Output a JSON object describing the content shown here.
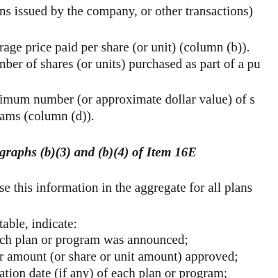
{
  "document": {
    "lines": [
      "ns issued by the company, or other transactions)",
      "rage price paid per share (or unit) (column (b)).",
      "nber of shares (or units) purchased as part of a pu",
      "imum number (or approximate dollar value) of s",
      "ams (column (d)).",
      "graphs (b)(3) and (b)(4) of Item 16E",
      "se this information in the aggregate for all plans",
      "table, indicate:",
      "ch plan or program was announced;",
      "r amount (or share or unit amount) approved;",
      "ation date (if any) of each plan or program;"
    ]
  }
}
